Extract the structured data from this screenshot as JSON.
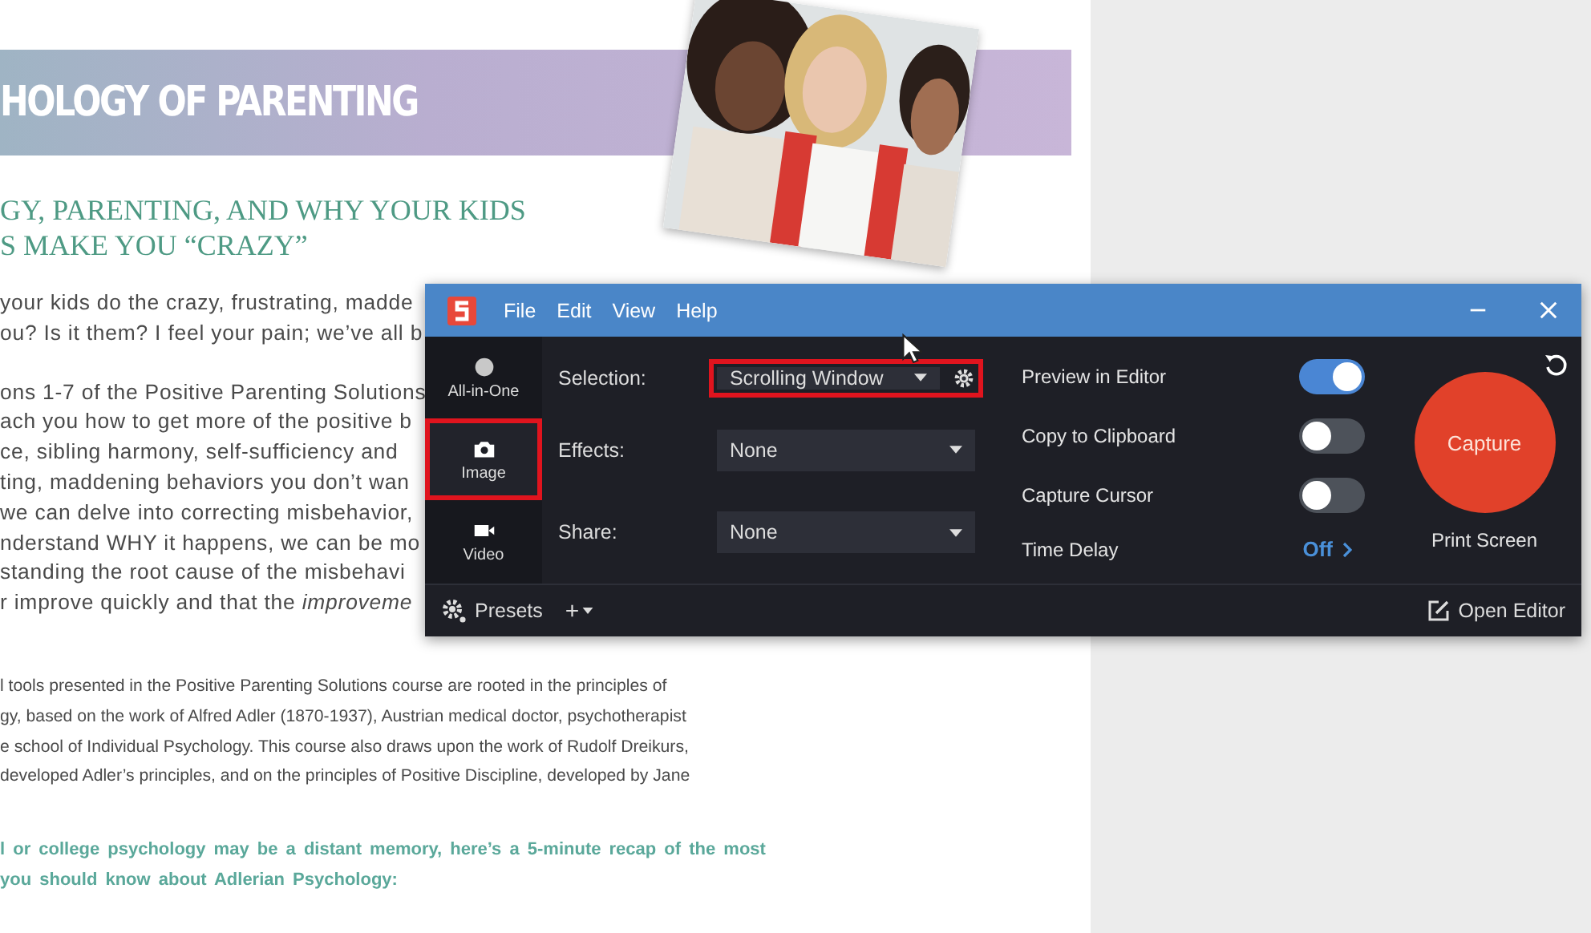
{
  "document": {
    "banner_title": "HOLOGY OF PARENTING",
    "subtitle_lines": [
      "GY, PARENTING, AND WHY YOUR KIDS",
      "S MAKE YOU “CRAZY”"
    ],
    "paragraphs": [
      {
        "kind": "cut",
        "lines": [
          "your kids do the crazy, frustrating, madde",
          "ou? Is it them? I feel your pain; we’ve all b"
        ]
      },
      {
        "kind": "cut",
        "lines": [
          "ons 1-7 of the Positive Parenting Solutions",
          "ach you how to get more of the positive b",
          "ce, sibling harmony, self-sufficiency and",
          "ting, maddening behaviors you don’t wan",
          "we can delve into correcting misbehavior,",
          "nderstand WHY it happens, we can be mo",
          "standing the root cause of the misbehavi",
          "r improve quickly and that the *improveme*"
        ]
      },
      {
        "kind": "body",
        "lines": [
          "l tools presented in the Positive Parenting Solutions course are rooted in the principles of",
          "gy, based on the work of Alfred Adler (1870-1937), Austrian medical doctor, psychotherapist",
          "e school of Individual Psychology. This course also draws upon the work of Rudolf Dreikurs,",
          "developed Adler’s principles, and on the principles of Positive Discipline, developed by Jane"
        ]
      },
      {
        "kind": "highlight",
        "lines": [
          "l or college psychology may be a distant memory, here’s a 5-minute recap of the most",
          "you should know about Adlerian Psychology:"
        ]
      }
    ]
  },
  "capture_window": {
    "menu": [
      "File",
      "Edit",
      "View",
      "Help"
    ],
    "capture_types": [
      {
        "label": "All-in-One",
        "kind": "circle",
        "selected": false
      },
      {
        "label": "Image",
        "kind": "camera",
        "selected": true
      },
      {
        "label": "Video",
        "kind": "video",
        "selected": false
      }
    ],
    "settings": [
      {
        "label": "Selection:",
        "value": "Scrolling Window",
        "kind": "gear",
        "highlighted": true
      },
      {
        "label": "Effects:",
        "value": "None",
        "kind": "plain",
        "highlighted": false
      },
      {
        "label": "Share:",
        "value": "None",
        "kind": "plain",
        "highlighted": false
      }
    ],
    "options": [
      {
        "label": "Preview in Editor",
        "kind": "toggle",
        "on": true
      },
      {
        "label": "Copy to Clipboard",
        "kind": "toggle",
        "on": false
      },
      {
        "label": "Capture Cursor",
        "kind": "toggle",
        "on": false
      },
      {
        "label": "Time Delay",
        "kind": "link",
        "value": "Off"
      }
    ],
    "capture_button": "Capture",
    "shortcut": "Print Screen",
    "presets": "Presets",
    "add": "+",
    "open_editor": "Open Editor"
  }
}
